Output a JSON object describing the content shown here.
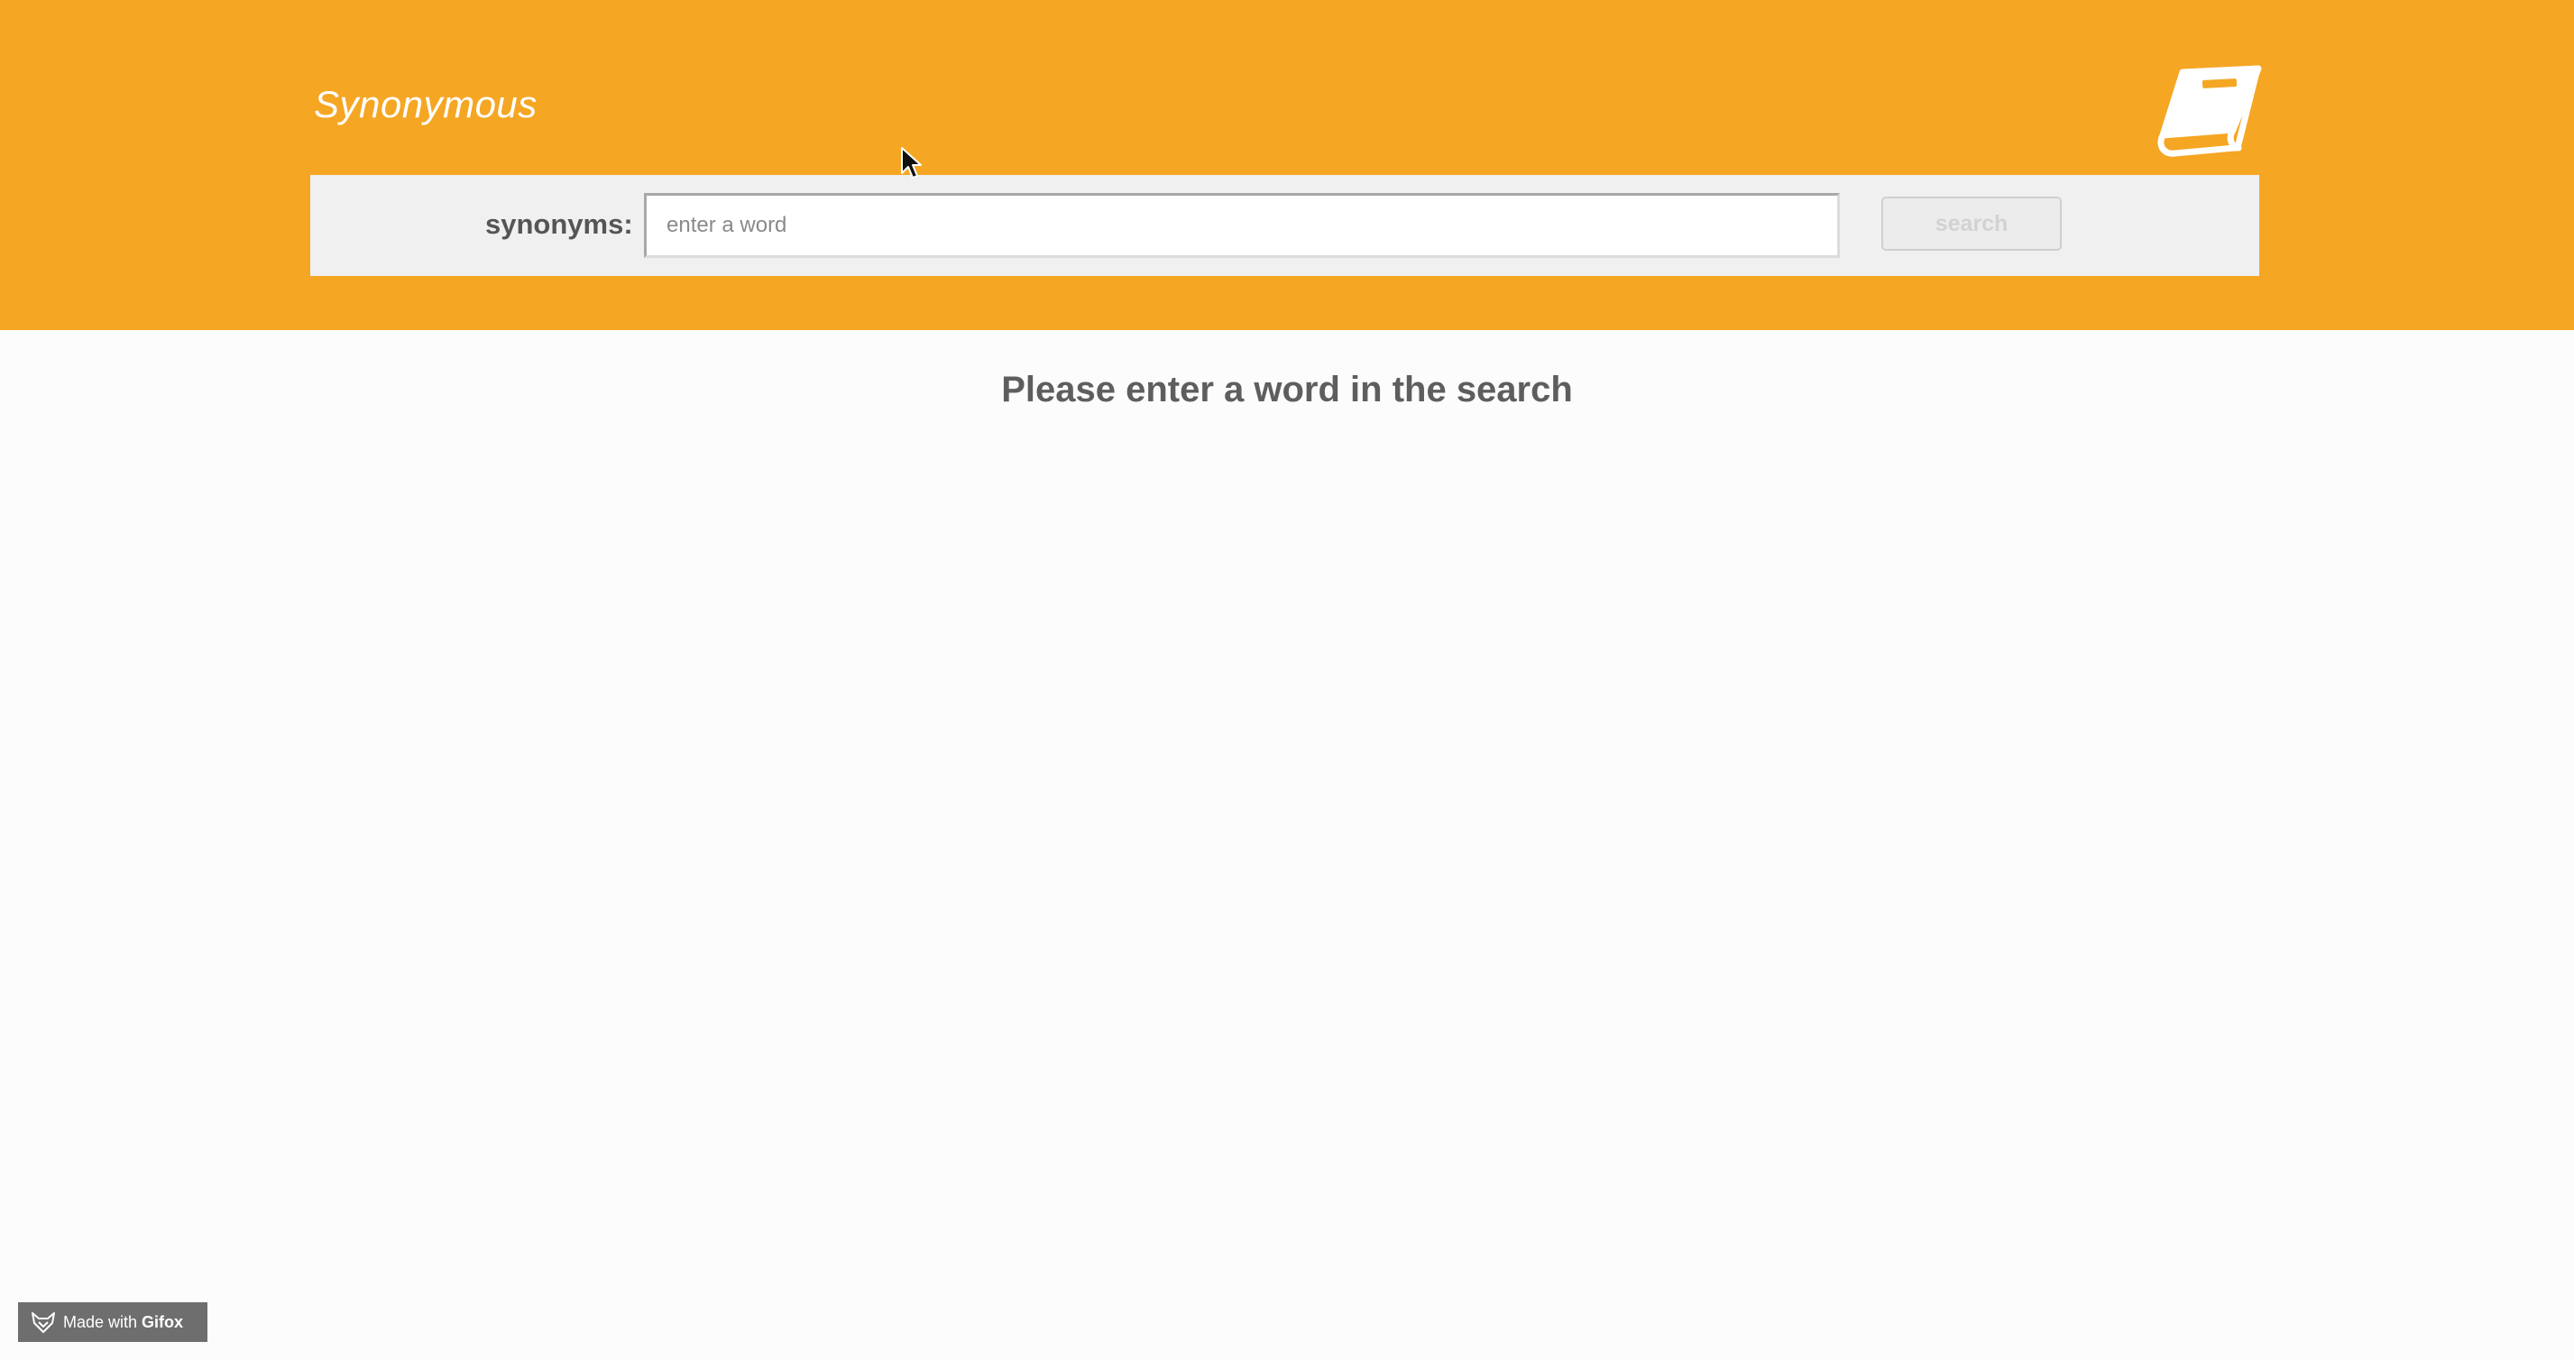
{
  "header": {
    "title": "Synonymous",
    "logo_icon": "book-icon",
    "background_color": "#f5a623"
  },
  "search": {
    "label": "synonyms:",
    "input_value": "",
    "placeholder": "enter a word",
    "button_label": "search",
    "button_state": "disabled"
  },
  "main": {
    "empty_message": "Please enter a word in the search"
  },
  "badge": {
    "prefix": "Made with ",
    "brand": "Gifox",
    "icon": "fox-icon"
  }
}
